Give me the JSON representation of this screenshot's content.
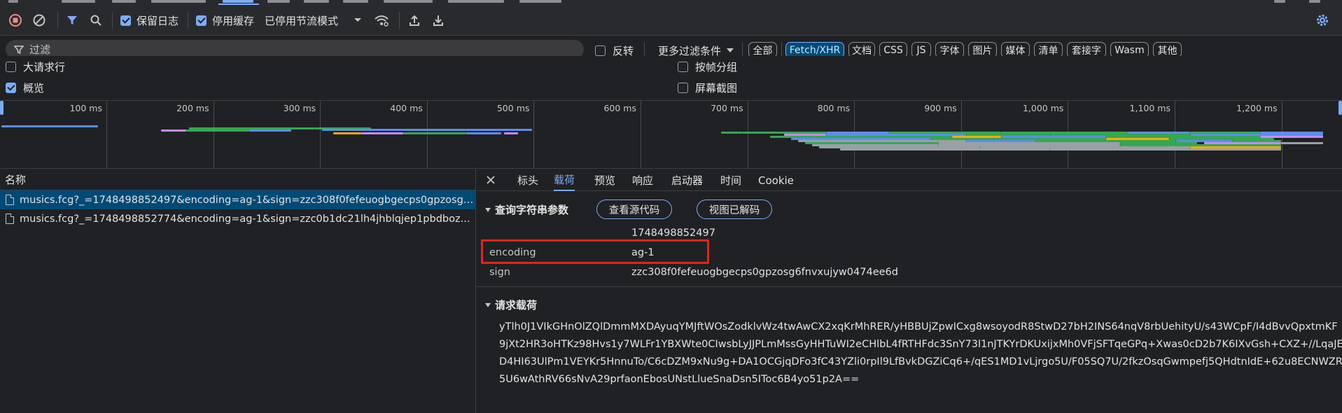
{
  "toolbar": {
    "preserve_log_label": "保留日志",
    "preserve_log_checked": true,
    "disable_cache_label": "停用缓存",
    "disable_cache_checked": true,
    "throttling_value": "已停用节流模式"
  },
  "filter": {
    "placeholder": "过滤",
    "invert_label": "反转",
    "more_filters_label": "更多过滤条件",
    "type_pills": [
      "全部",
      "Fetch/XHR",
      "文档",
      "CSS",
      "JS",
      "字体",
      "图片",
      "媒体",
      "清单",
      "套接字",
      "Wasm",
      "其他"
    ],
    "active_pill": "Fetch/XHR"
  },
  "options": {
    "big_request_rows": "大请求行",
    "overview": "概览",
    "group_by_frame": "按帧分组",
    "screenshots": "屏幕截图",
    "overview_checked": true
  },
  "overview_timeline": {
    "ticks": [
      "100 ms",
      "200 ms",
      "300 ms",
      "400 ms",
      "500 ms",
      "600 ms",
      "700 ms",
      "800 ms",
      "900 ms",
      "1,000 ms",
      "1,100 ms",
      "1,200 ms"
    ],
    "colors": {
      "green": "#34a853",
      "blue": "#5b8def",
      "purple": "#c58af9",
      "orange": "#f9ab00",
      "gray": "#9aa0a6"
    }
  },
  "request_list": {
    "column_header": "名称",
    "rows": [
      {
        "name": "musics.fcg?_=1748498852497&encoding=ag-1&sign=zzc308f0fefeuogbgecps0gpzosg6...",
        "selected": true
      },
      {
        "name": "musics.fcg?_=1748498852774&encoding=ag-1&sign=zzc0b1dc21lh4jhblqjep1pbdboz...",
        "selected": false
      }
    ]
  },
  "detail": {
    "tabs": [
      "标头",
      "载荷",
      "预览",
      "响应",
      "启动器",
      "时间",
      "Cookie"
    ],
    "active_tab": "载荷",
    "query_section_title": "查询字符串参数",
    "view_source_button": "查看源代码",
    "view_decoded_button": "视图已解码",
    "params": [
      {
        "key": "",
        "value": "1748498852497"
      },
      {
        "key": "encoding",
        "value": "ag-1"
      },
      {
        "key": "sign",
        "value": "zzc308f0fefeuogbgecps0gpzosg6fnvxujyw0474ee6d"
      }
    ],
    "payload_section_title": "请求载荷",
    "payload_lines": [
      "yTlh0J1VIkGHnOlZQlDmmMXDAyuqYMJftWOsZodklvWz4twAwCX2xqKrMhRER/yHBBUjZpwICxg8wsoyodR8StwD27bH2INS64nqV8rbUehityU/s43WCpF/I4dBvvQpxtmKF",
      "9jXt2HR3oHTKz98Hvs1y7WLFr1YBXWte0CIwsbLyJJPLmMssGyHHTuWI2eCHlbL4fRTHFdc3SnY73l1nJTKYrDKUxijxMh0VFjSFTqeGPq+Xwas0cD2b7K6IXvGsh+CXZ+//LqaJE",
      "D4HI63UlPm1VEYKr5HnnuTo/C6cDZM9xNu9g+DA1OCGjqDFo3fC43YZli0rpIl9LfBvkDGZiCq6+/qES1MD1vLjrgo5U/F05SQ7U/2fkzOsqGwmpefj5QHdtnIdE+62u8ECNWZR",
      "5U6wAthRV66sNvA29prfaonEbosUNstLlueSnaDsn5IToc6B4yo51p2A=="
    ]
  }
}
